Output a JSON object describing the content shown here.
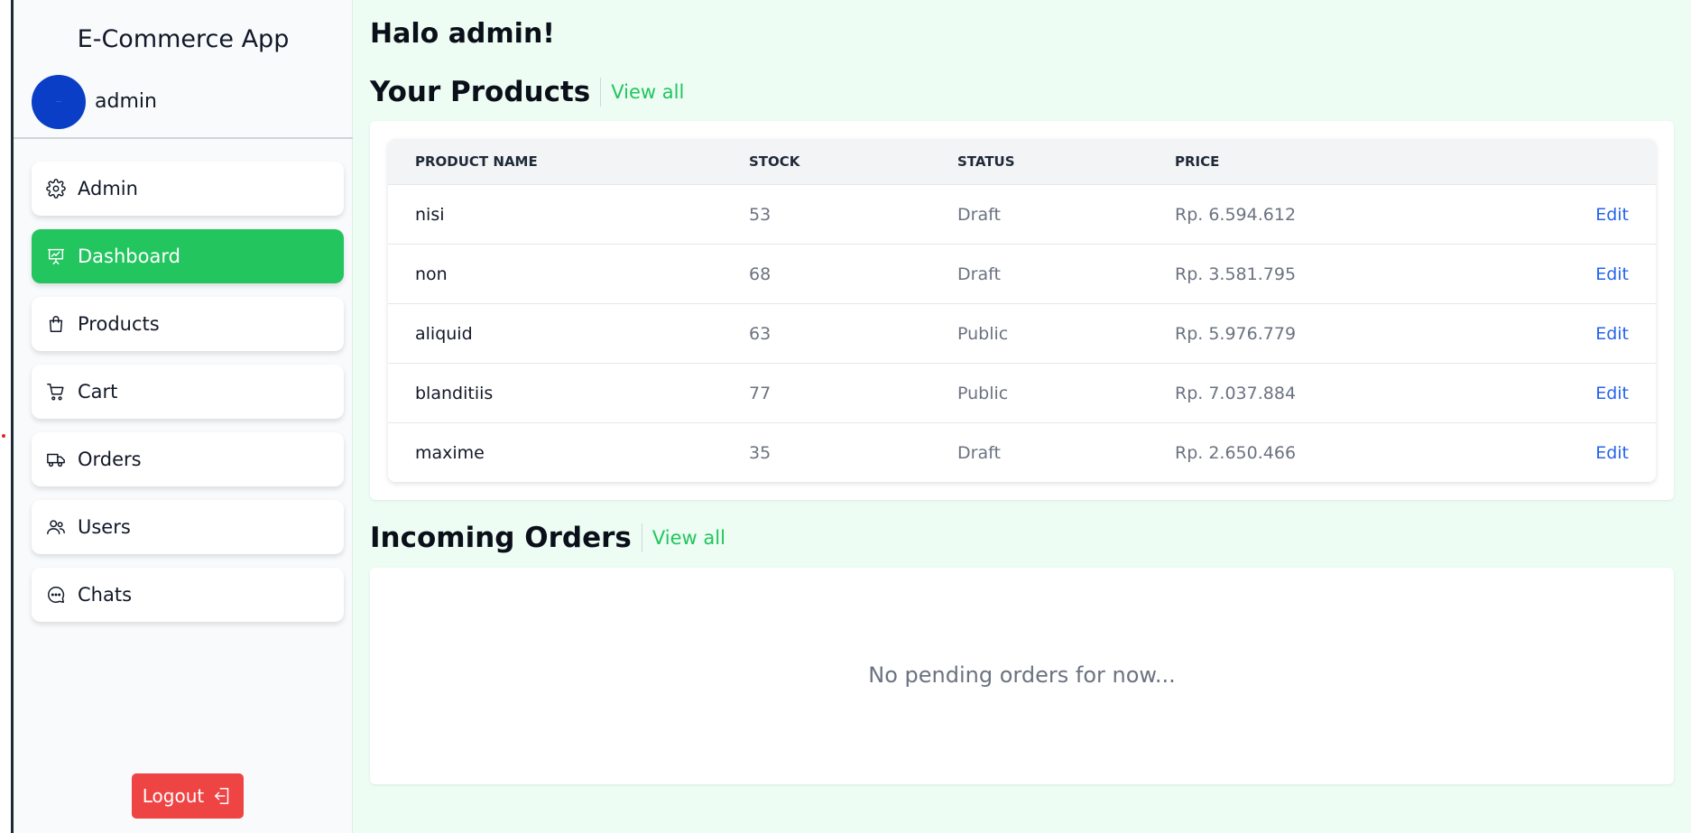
{
  "app": {
    "title": "E-Commerce App"
  },
  "user": {
    "name": "admin",
    "avatar_text": "···"
  },
  "sidebar": {
    "items": [
      {
        "label": "Admin",
        "icon": "gear-icon"
      },
      {
        "label": "Dashboard",
        "icon": "presentation-chart-icon"
      },
      {
        "label": "Products",
        "icon": "shopping-bag-icon"
      },
      {
        "label": "Cart",
        "icon": "cart-icon"
      },
      {
        "label": "Orders",
        "icon": "truck-icon"
      },
      {
        "label": "Users",
        "icon": "users-icon"
      },
      {
        "label": "Chats",
        "icon": "chat-icon"
      }
    ],
    "active": "Dashboard",
    "logout_label": "Logout"
  },
  "main": {
    "greeting": "Halo admin!",
    "products_section": {
      "title": "Your Products",
      "view_all": "View all",
      "columns": [
        "PRODUCT NAME",
        "STOCK",
        "STATUS",
        "PRICE"
      ],
      "rows": [
        {
          "name": "nisi",
          "stock": "53",
          "status": "Draft",
          "price": "Rp. 6.594.612",
          "action": "Edit"
        },
        {
          "name": "non",
          "stock": "68",
          "status": "Draft",
          "price": "Rp. 3.581.795",
          "action": "Edit"
        },
        {
          "name": "aliquid",
          "stock": "63",
          "status": "Public",
          "price": "Rp. 5.976.779",
          "action": "Edit"
        },
        {
          "name": "blanditiis",
          "stock": "77",
          "status": "Public",
          "price": "Rp. 7.037.884",
          "action": "Edit"
        },
        {
          "name": "maxime",
          "stock": "35",
          "status": "Draft",
          "price": "Rp. 2.650.466",
          "action": "Edit"
        }
      ]
    },
    "orders_section": {
      "title": "Incoming Orders",
      "view_all": "View all",
      "empty_message": "No pending orders for now..."
    }
  },
  "colors": {
    "accent": "#22c55e",
    "danger": "#ef4444",
    "link": "#2563eb",
    "avatar": "#0a3ec7",
    "main_bg": "#edfdf3"
  }
}
